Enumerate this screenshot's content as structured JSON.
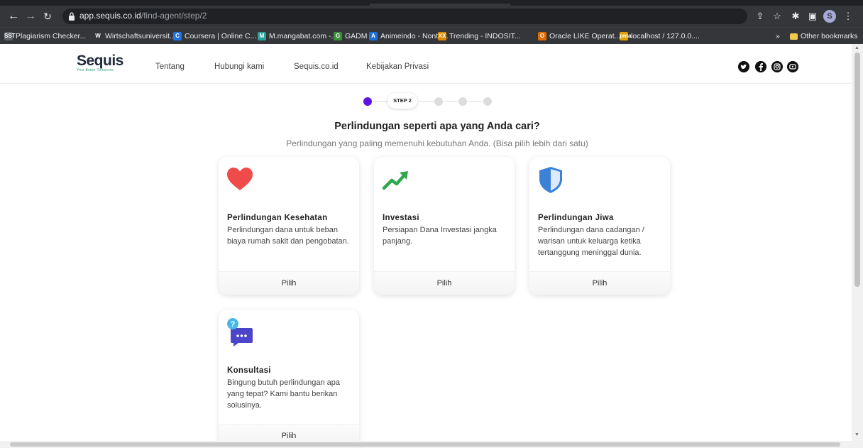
{
  "browser": {
    "url_host": "app.sequis.co.id",
    "url_path": "/find-agent/step/2",
    "avatar_letter": "S",
    "bookmarks": [
      {
        "label": "Plagiarism Checker...",
        "icon": "SST",
        "color": "#5f6368"
      },
      {
        "label": "Wirtschaftsuniversit...",
        "icon": "W",
        "color": "#35363a"
      },
      {
        "label": "Coursera | Online C...",
        "icon": "C",
        "color": "#1f74e0"
      },
      {
        "label": "M.mangabat.com -...",
        "icon": "M",
        "color": "#2aa198"
      },
      {
        "label": "GADM",
        "icon": "G",
        "color": "#3c8f3c"
      },
      {
        "label": "Animeindo - Nonto...",
        "icon": "A",
        "color": "#1e6fd9"
      },
      {
        "label": "Trending - INDOSIT...",
        "icon": "XX",
        "color": "#d98a00"
      },
      {
        "label": "Oracle LIKE Operat...",
        "icon": "O",
        "color": "#e06b00"
      },
      {
        "label": "localhost / 127.0.0....",
        "icon": "pma",
        "color": "#e0a000"
      }
    ],
    "overflow_label": "»",
    "other_bookmarks": "Other bookmarks"
  },
  "header": {
    "logo_word": "Sequis",
    "logo_tagline": "Your Better Tomorrow",
    "nav": [
      "Tentang",
      "Hubungi kami",
      "Sequis.co.id",
      "Kebijakan Privasi"
    ],
    "social_icons": [
      "twitter-icon",
      "facebook-icon",
      "instagram-icon",
      "youtube-icon"
    ]
  },
  "steps": {
    "active_label": "STEP 2",
    "total": 5,
    "current": 2
  },
  "question": {
    "title": "Perlindungan seperti apa yang Anda cari?",
    "subtitle": "Perlindungan yang paling memenuhi kebutuhan Anda. (Bisa pilih lebih dari satu)"
  },
  "cards": [
    {
      "icon": "heart-icon",
      "title": "Perlindungan Kesehatan",
      "desc": "Perlindungan dana untuk beban biaya rumah sakit dan pengobatan.",
      "action": "Pilih"
    },
    {
      "icon": "trending-up-icon",
      "title": "Investasi",
      "desc": "Persiapan Dana Investasi jangka panjang.",
      "action": "Pilih"
    },
    {
      "icon": "shield-icon",
      "title": "Perlindungan Jiwa",
      "desc": "Perlindungan dana cadangan / warisan untuk keluarga ketika tertanggung meninggal dunia.",
      "action": "Pilih"
    },
    {
      "icon": "chat-question-icon",
      "title": "Konsultasi",
      "desc": "Bingung butuh perlindungan apa yang tepat? Kami bantu berikan solusinya.",
      "action": "Pilih"
    }
  ],
  "colors": {
    "accent": "#5b16e0",
    "heart": "#ef4b4b",
    "trend": "#2ea84a",
    "shield": "#3b82d6",
    "chat": "#4b45c9"
  }
}
